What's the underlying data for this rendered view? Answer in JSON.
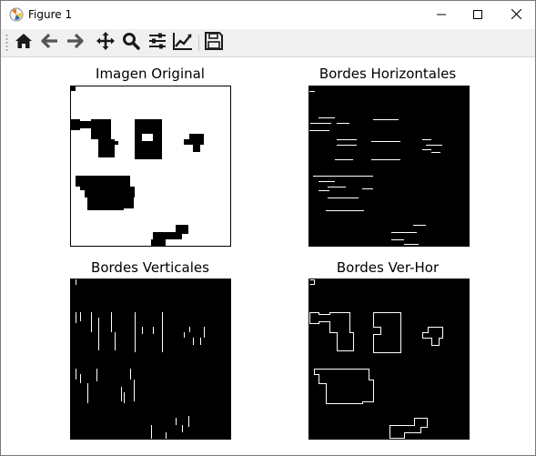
{
  "window": {
    "title": "Figure 1",
    "icon": "matplotlib-figure-icon",
    "controls": [
      "minimize-icon",
      "maximize-icon",
      "close-icon"
    ]
  },
  "toolbar": {
    "tools": [
      {
        "name": "home",
        "icon": "home-icon"
      },
      {
        "name": "back",
        "icon": "arrow-left-icon"
      },
      {
        "name": "forward",
        "icon": "arrow-right-icon"
      },
      {
        "name": "pan",
        "icon": "move-icon"
      },
      {
        "name": "zoom",
        "icon": "magnifier-icon"
      },
      {
        "name": "configure-subplots",
        "icon": "sliders-icon"
      },
      {
        "name": "edit-axis",
        "icon": "line-chart-icon"
      },
      {
        "name": "save",
        "icon": "floppy-disk-icon"
      }
    ]
  },
  "figure": {
    "subplots": [
      {
        "title": "Imagen Original",
        "background": "#ffffff",
        "foreground": "#000000"
      },
      {
        "title": "Bordes Horizontales",
        "background": "#000000",
        "foreground": "#ffffff"
      },
      {
        "title": "Bordes Verticales",
        "background": "#000000",
        "foreground": "#ffffff"
      },
      {
        "title": "Bordes Ver-Hor",
        "background": "#000000",
        "foreground": "#ffffff"
      }
    ]
  },
  "colors": {
    "toolbar_bg": "#f0f0f0",
    "icon": "#1a1a1a"
  }
}
